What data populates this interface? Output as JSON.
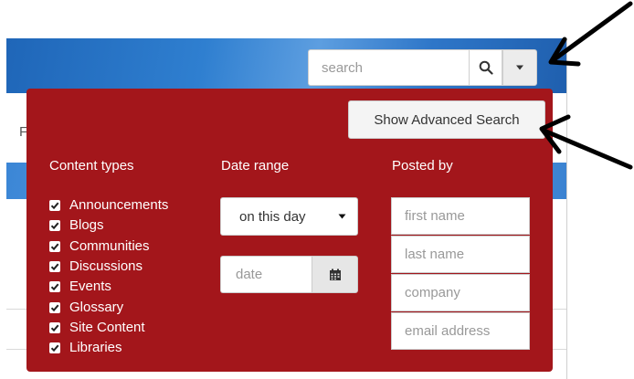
{
  "search": {
    "placeholder": "search",
    "value": ""
  },
  "background": {
    "partial_text": "F"
  },
  "panel": {
    "advanced_button_label": "Show Advanced Search",
    "content_types": {
      "heading": "Content types",
      "items": [
        {
          "label": "Announcements",
          "checked": true
        },
        {
          "label": "Blogs",
          "checked": true
        },
        {
          "label": "Communities",
          "checked": true
        },
        {
          "label": "Discussions",
          "checked": true
        },
        {
          "label": "Events",
          "checked": true
        },
        {
          "label": "Glossary",
          "checked": true
        },
        {
          "label": "Site Content",
          "checked": true
        },
        {
          "label": "Libraries",
          "checked": true
        }
      ]
    },
    "date_range": {
      "heading": "Date range",
      "selected": "on this day",
      "date_placeholder": "date"
    },
    "posted_by": {
      "heading": "Posted by",
      "first_name_placeholder": "first name",
      "last_name_placeholder": "last name",
      "company_placeholder": "company",
      "email_placeholder": "email address"
    }
  },
  "colors": {
    "panel_bg": "#a3161b",
    "panel_text": "#ffffff",
    "banner_blue": "#2f7fd0",
    "annotation_arrow": "#000000"
  },
  "icons": {
    "search_button": "magnifier-icon",
    "dropdown_button": "caret-down-icon",
    "select_arrow": "caret-down-icon",
    "calendar_button": "calendar-icon",
    "checkbox": "checkmark-icon"
  }
}
